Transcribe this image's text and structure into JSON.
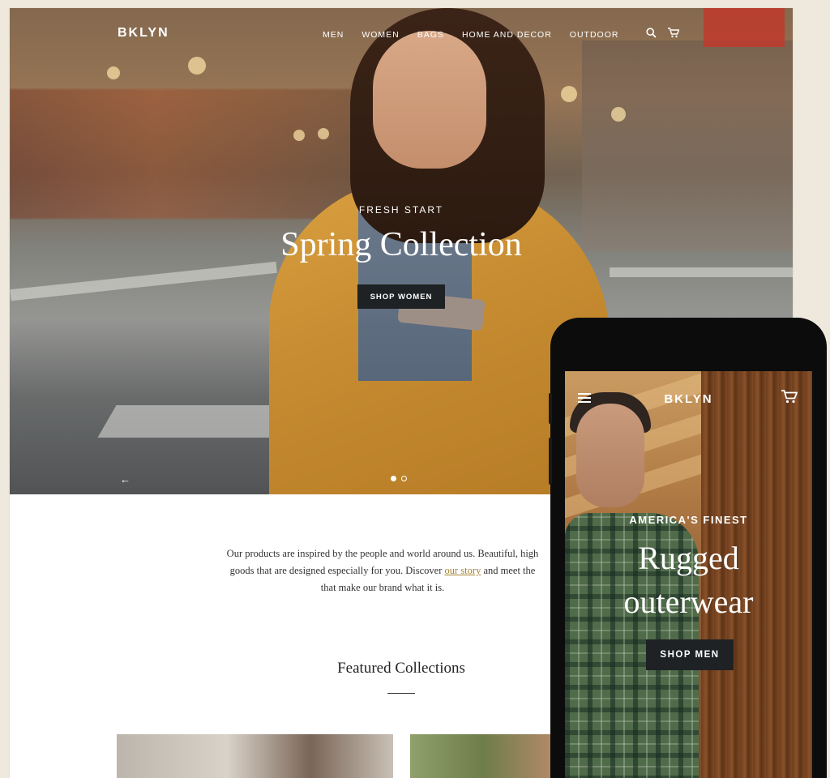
{
  "desktop": {
    "logo": "BKLYN",
    "nav": [
      "MEN",
      "WOMEN",
      "BAGS",
      "HOME AND DECOR",
      "OUTDOOR"
    ],
    "icons": {
      "search": "search-icon",
      "cart": "cart-icon",
      "prev": "arrow-left-icon"
    },
    "hero": {
      "kicker": "FRESH START",
      "title": "Spring Collection",
      "button": "SHOP WOMEN",
      "slide_count": 2,
      "active_slide": 1
    },
    "intro": {
      "line1": "Our products are inspired by the people and world around us. Beautiful, high",
      "line2_before": "goods that are designed especially for you. Discover ",
      "line2_link": "our story",
      "line2_after": " and meet the",
      "line3": "that make our brand what it is."
    },
    "featured_title": "Featured Collections"
  },
  "phone": {
    "menu_icon": "menu-icon",
    "logo": "BKLYN",
    "cart_icon": "cart-icon",
    "kicker": "AMERICA'S FINEST",
    "title_line1": "Rugged",
    "title_line2": "outerwear",
    "button": "SHOP MEN"
  },
  "colors": {
    "page_bg": "#efe8dc",
    "button_bg": "#1f2224",
    "link": "#a6822f",
    "phone_frame": "#0c0c0c"
  }
}
